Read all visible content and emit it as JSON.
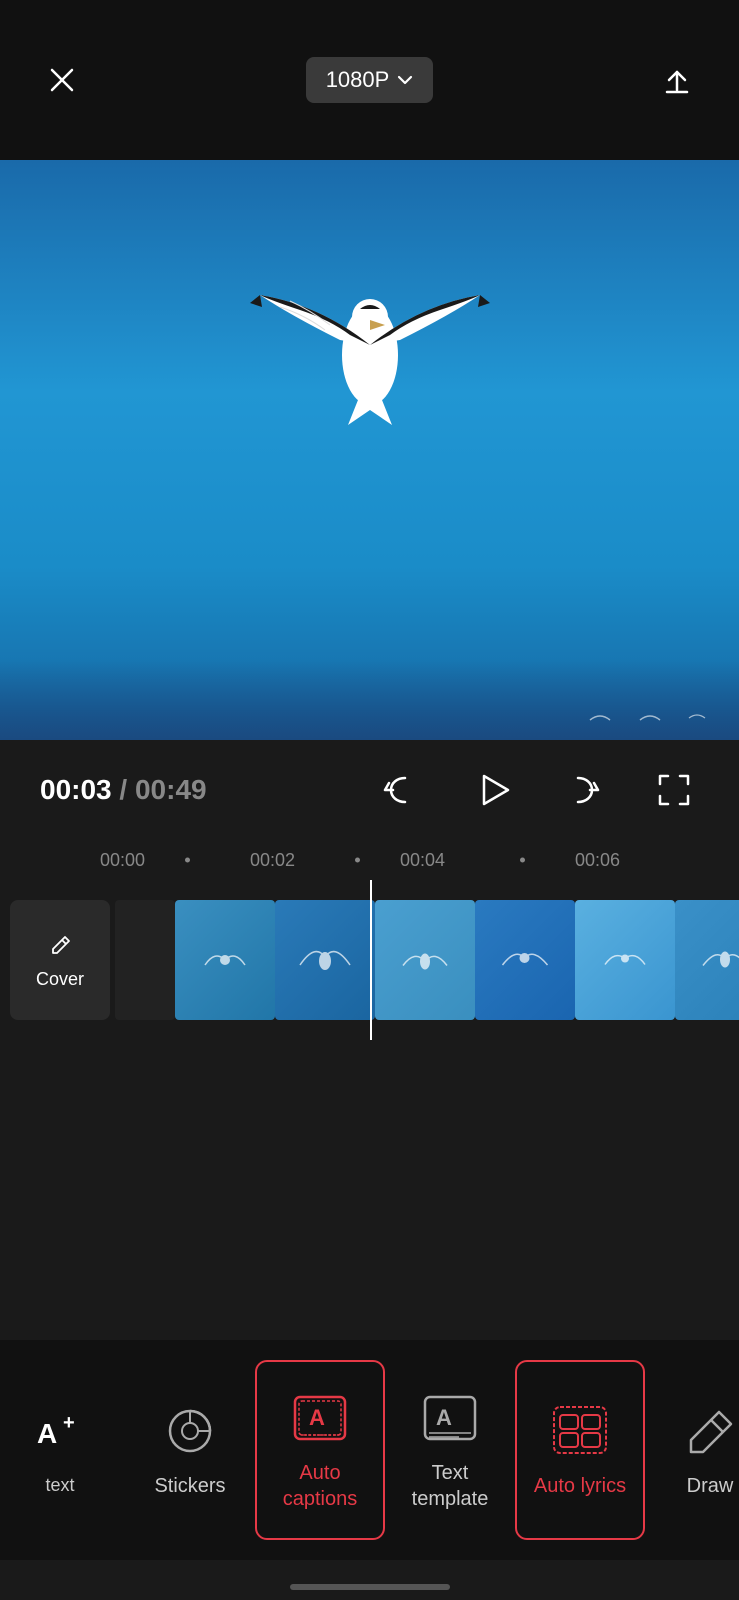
{
  "header": {
    "resolution_label": "1080P",
    "close_label": "×"
  },
  "video": {
    "current_time": "00:03",
    "total_time": "00:49",
    "time_separator": " / "
  },
  "timeline": {
    "ruler_marks": [
      "00:00",
      "00:02",
      "00:04",
      "00:06"
    ],
    "cover_label": "Cover"
  },
  "toolbar": {
    "items": [
      {
        "id": "add-text",
        "label": "A+\ntext",
        "icon": "A+",
        "active": false,
        "partial": true
      },
      {
        "id": "stickers",
        "label": "Stickers",
        "icon": "sticker",
        "active": false
      },
      {
        "id": "auto-captions",
        "label": "Auto\ncaptions",
        "icon": "auto-caption",
        "active": true
      },
      {
        "id": "text-template",
        "label": "Text\ntemplate",
        "icon": "text-template",
        "active": false
      },
      {
        "id": "auto-lyrics",
        "label": "Auto lyrics",
        "icon": "auto-lyrics",
        "active": true
      },
      {
        "id": "draw",
        "label": "Draw",
        "icon": "draw",
        "active": false
      }
    ]
  }
}
